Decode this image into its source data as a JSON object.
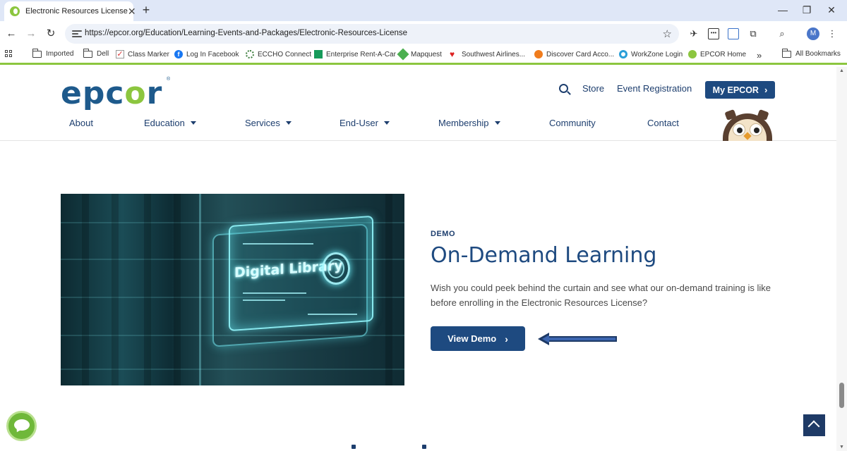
{
  "browser": {
    "tab": {
      "title": "Electronic Resources License",
      "close": "✕"
    },
    "new_tab": "+",
    "window": {
      "minimize": "—",
      "restore": "❐",
      "close": "✕"
    },
    "nav": {
      "back": "←",
      "forward": "→",
      "reload": "↻"
    },
    "url": "https://epcor.org/Education/Learning-Events-and-Packages/Electronic-Resources-License",
    "star": "☆",
    "avatar_letter": "M",
    "menu": "⋮"
  },
  "bookmarks": {
    "items": [
      {
        "label": "Imported",
        "icon": "folder-icon"
      },
      {
        "label": "Dell",
        "icon": "folder-icon"
      },
      {
        "label": "Class Marker",
        "icon": "checkmark-icon"
      },
      {
        "label": "Log In  Facebook",
        "icon": "facebook-icon"
      },
      {
        "label": "ECCHO Connect",
        "icon": "gear-icon"
      },
      {
        "label": "Enterprise Rent-A-Car",
        "icon": "enterprise-icon"
      },
      {
        "label": "Mapquest",
        "icon": "mapquest-icon"
      },
      {
        "label": "Southwest Airlines...",
        "icon": "heart-icon"
      },
      {
        "label": "Discover Card Acco...",
        "icon": "discover-icon"
      },
      {
        "label": "WorkZone Login",
        "icon": "workzone-icon"
      },
      {
        "label": "EPCOR Home",
        "icon": "epcor-icon"
      }
    ],
    "more": "»",
    "all_bookmarks": "All Bookmarks",
    "colors": {
      "green": "#8cc63f"
    }
  },
  "site": {
    "logo": {
      "pre": "epc",
      "o": "o",
      "post": "r",
      "reg": "®"
    },
    "util": {
      "store": "Store",
      "event_registration": "Event Registration",
      "my_epcor": "My EPCOR",
      "chev": "›"
    },
    "nav": [
      {
        "label": "About",
        "dropdown": false
      },
      {
        "label": "Education",
        "dropdown": true
      },
      {
        "label": "Services",
        "dropdown": true
      },
      {
        "label": "End-User",
        "dropdown": true
      },
      {
        "label": "Membership",
        "dropdown": true
      },
      {
        "label": "Community",
        "dropdown": false
      },
      {
        "label": "Contact",
        "dropdown": false
      }
    ],
    "colors": {
      "navy": "#1e4a80",
      "text": "#1d3e6e",
      "green": "#8cc63f"
    }
  },
  "hero": {
    "image_text": "Digital Library",
    "eyebrow": "DEMO",
    "title": "On-Demand Learning",
    "description": "Wish you could peek behind the curtain and see what our on-demand training is like before enrolling in the Electronic Resources License?",
    "button": "View Demo",
    "button_chev": "›"
  }
}
